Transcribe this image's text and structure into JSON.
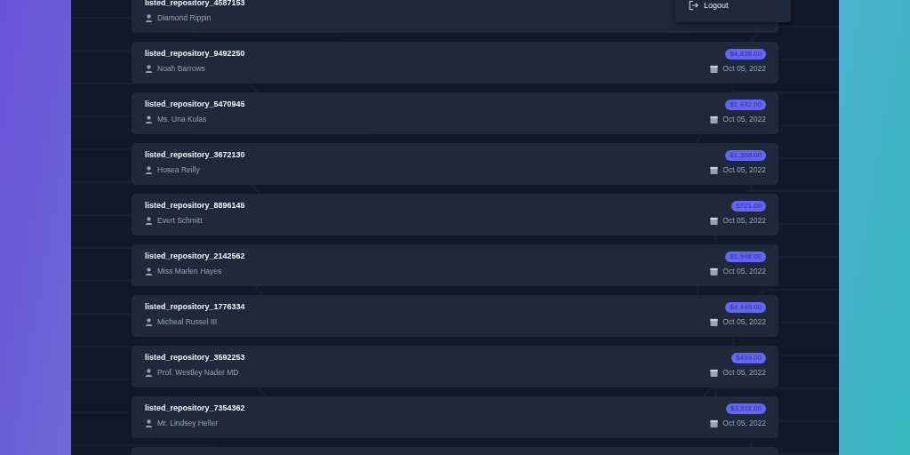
{
  "menu": {
    "items": [
      {
        "label": "Logout"
      }
    ]
  },
  "repositories": [
    {
      "name": "listed_repository_4587153",
      "owner": "Diamond Rippin"
    },
    {
      "name": "listed_repository_9492250",
      "owner": "Noah Barrows",
      "price": "$4,838.00",
      "date": "Oct 05, 2022"
    },
    {
      "name": "listed_repository_5470945",
      "owner": "Ms. Una Kulas",
      "price": "$1,932.00",
      "date": "Oct 05, 2022"
    },
    {
      "name": "listed_repository_3672130",
      "owner": "Hosea Reilly",
      "price": "$1,368.00",
      "date": "Oct 05, 2022"
    },
    {
      "name": "listed_repository_8896145",
      "owner": "Evert Schmitt",
      "price": "$721.00",
      "date": "Oct 05, 2022"
    },
    {
      "name": "listed_repository_2142562",
      "owner": "Miss Marlen Hayes",
      "price": "$1,948.00",
      "date": "Oct 05, 2022"
    },
    {
      "name": "listed_repository_1776334",
      "owner": "Micheal Russel III",
      "price": "$4,449.00",
      "date": "Oct 05, 2022"
    },
    {
      "name": "listed_repository_3592253",
      "owner": "Prof. Westley Nader MD",
      "price": "$499.00",
      "date": "Oct 05, 2022"
    },
    {
      "name": "listed_repository_7354362",
      "owner": "Mr. Lindsey Heller",
      "price": "$3,911.00",
      "date": "Oct 05, 2022"
    }
  ]
}
